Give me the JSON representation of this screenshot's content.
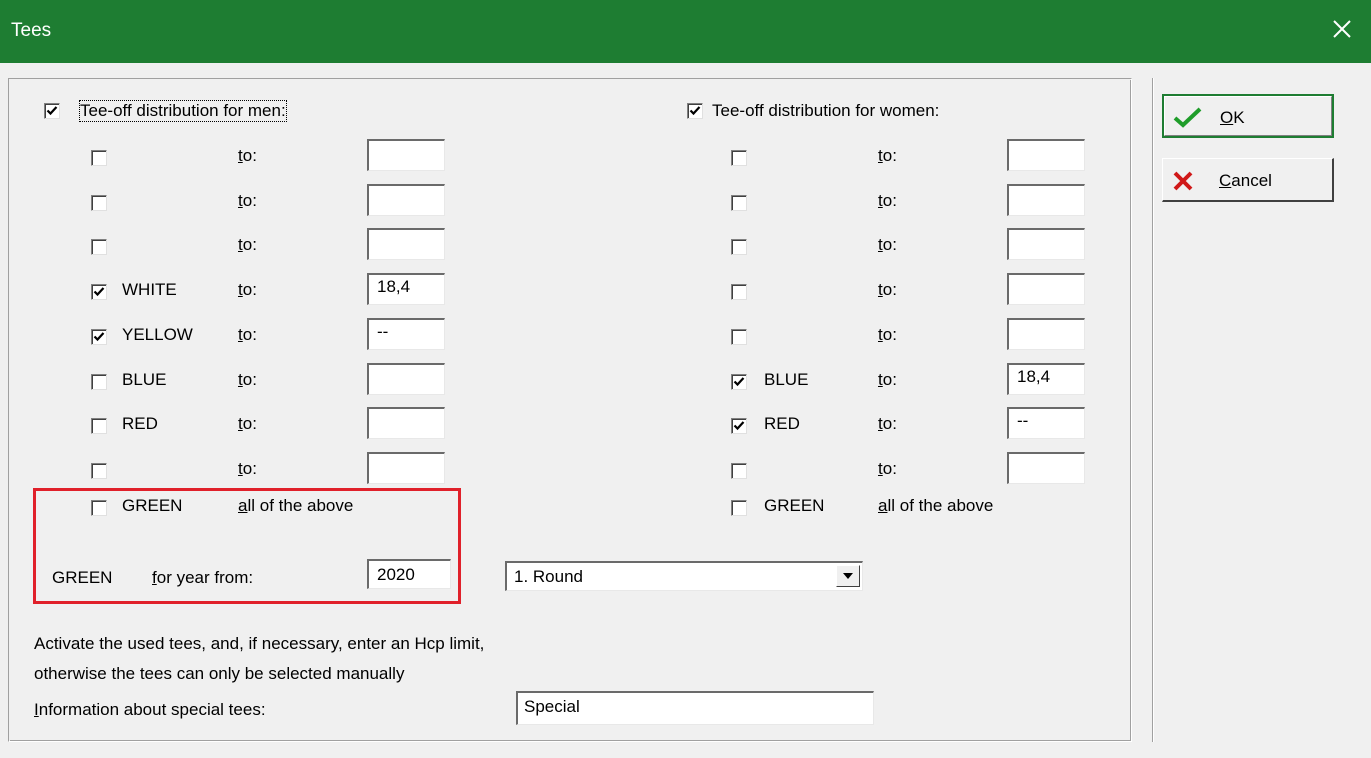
{
  "window": {
    "title": "Tees"
  },
  "men": {
    "header": "Tee-off distribution for men:",
    "header_checked": true,
    "rows": [
      {
        "checked": false,
        "color": "",
        "to_label": "to:",
        "value": ""
      },
      {
        "checked": false,
        "color": "",
        "to_label": "to:",
        "value": ""
      },
      {
        "checked": false,
        "color": "",
        "to_label": "to:",
        "value": ""
      },
      {
        "checked": true,
        "color": "WHITE",
        "to_label": "to:",
        "value": "18,4"
      },
      {
        "checked": true,
        "color": "YELLOW",
        "to_label": "to:",
        "value": "--"
      },
      {
        "checked": false,
        "color": "BLUE",
        "to_label": "to:",
        "value": ""
      },
      {
        "checked": false,
        "color": "RED",
        "to_label": "to:",
        "value": ""
      },
      {
        "checked": false,
        "color": "",
        "to_label": "to:",
        "value": ""
      }
    ],
    "green": {
      "checked": false,
      "color": "GREEN",
      "label": "all of the above"
    }
  },
  "women": {
    "header": "Tee-off distribution for women:",
    "header_checked": true,
    "rows": [
      {
        "checked": false,
        "color": "",
        "to_label": "to:",
        "value": ""
      },
      {
        "checked": false,
        "color": "",
        "to_label": "to:",
        "value": ""
      },
      {
        "checked": false,
        "color": "",
        "to_label": "to:",
        "value": ""
      },
      {
        "checked": false,
        "color": "",
        "to_label": "to:",
        "value": ""
      },
      {
        "checked": false,
        "color": "",
        "to_label": "to:",
        "value": ""
      },
      {
        "checked": true,
        "color": "BLUE",
        "to_label": "to:",
        "value": "18,4"
      },
      {
        "checked": true,
        "color": "RED",
        "to_label": "to:",
        "value": "--"
      },
      {
        "checked": false,
        "color": "",
        "to_label": "to:",
        "value": ""
      }
    ],
    "green": {
      "checked": false,
      "color": "GREEN",
      "label": "all of the above"
    }
  },
  "green_year": {
    "color": "GREEN",
    "label": "for year from:",
    "value": "2020",
    "round_selected": "1. Round"
  },
  "info": {
    "line1": "Activate the used tees, and, if necessary, enter an Hcp limit,",
    "line2": "otherwise the tees can only be selected manually",
    "special_label": "Information about special tees:",
    "special_value": "Special"
  },
  "buttons": {
    "ok": "OK",
    "cancel": "Cancel"
  },
  "colors": {
    "titlebar": "#1e7d32",
    "highlight": "#e0202a",
    "ok_check": "#1f9d2a",
    "cancel_x": "#d01818"
  }
}
